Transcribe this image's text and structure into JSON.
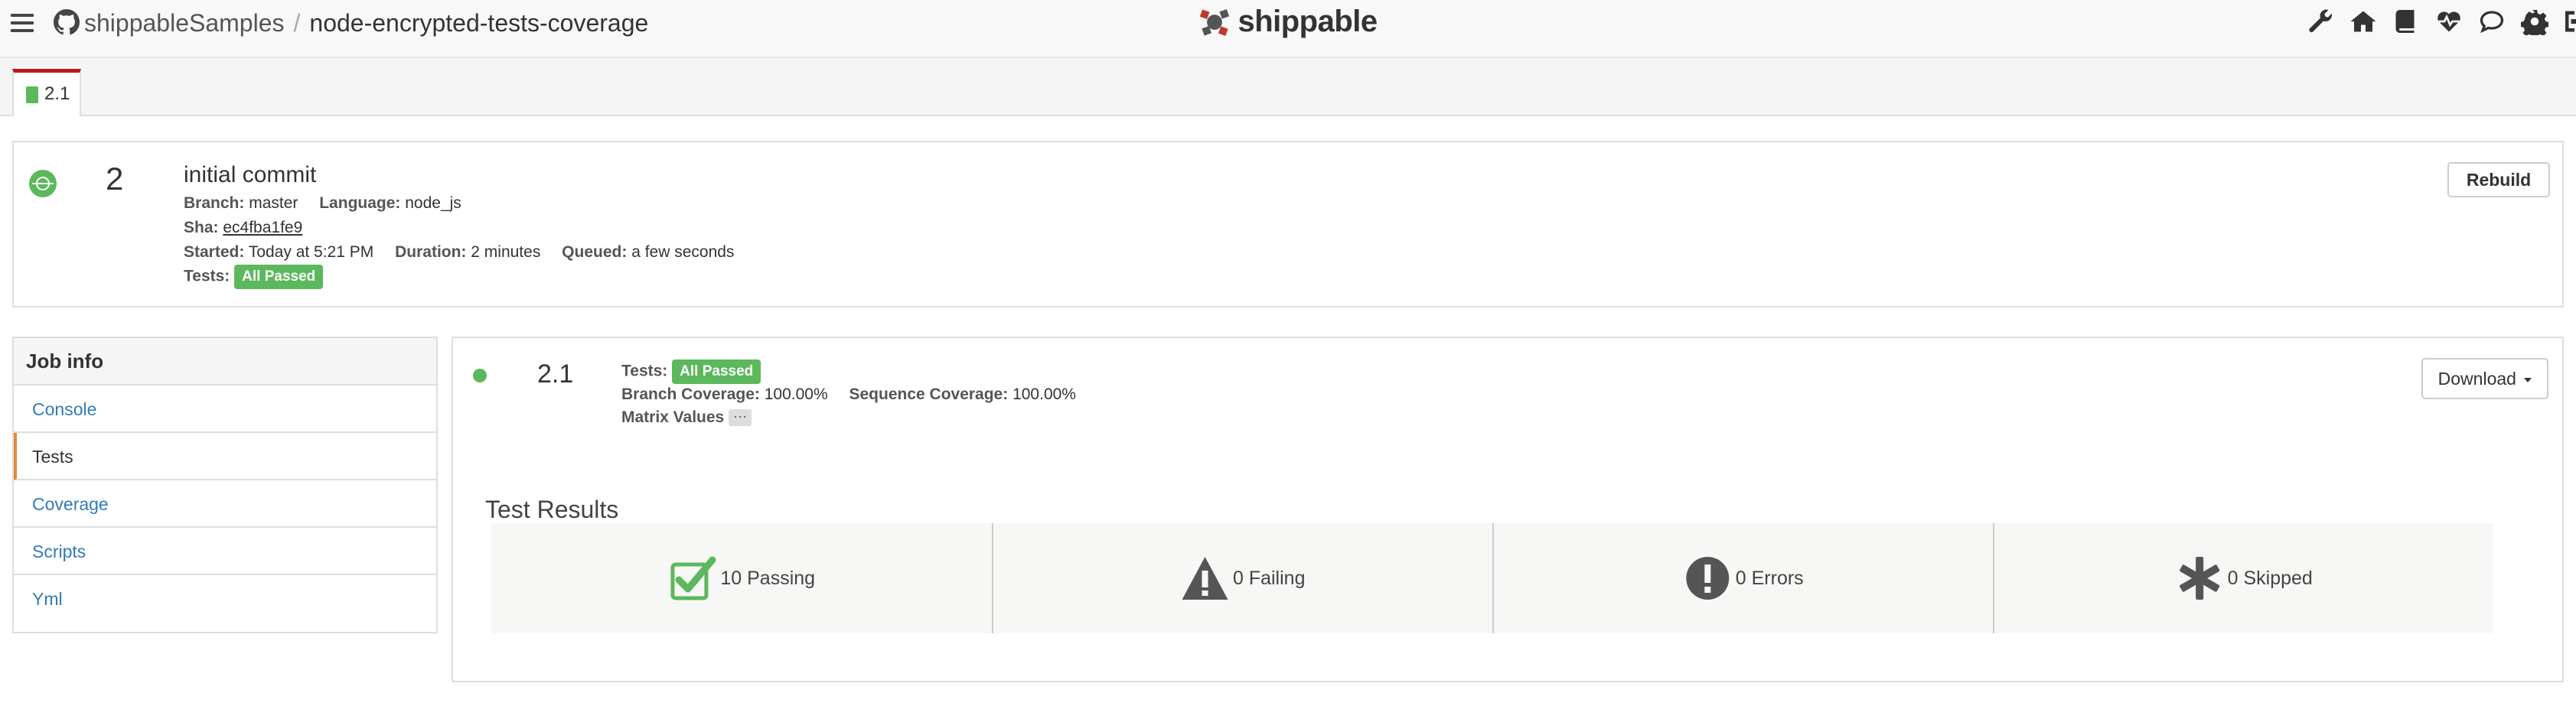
{
  "header": {
    "org": "shippableSamples",
    "separator": "/",
    "repo": "node-encrypted-tests-coverage",
    "brand": "shippable",
    "nav_icons": [
      "wrench-icon",
      "home-icon",
      "book-icon",
      "heartbeat-icon",
      "chat-icon",
      "gear-icon",
      "sign-out-icon"
    ]
  },
  "tabs": [
    {
      "label": "2.1",
      "status_color": "#5cb85c",
      "active_border": "#b91c1c"
    }
  ],
  "build": {
    "number": "2",
    "commit_message": "initial commit",
    "branch_label": "Branch:",
    "branch": "master",
    "language_label": "Language:",
    "language": "node_js",
    "sha_label": "Sha:",
    "sha": "ec4fba1fe9",
    "started_label": "Started:",
    "started": "Today at 5:21 PM",
    "duration_label": "Duration:",
    "duration": "2 minutes",
    "queued_label": "Queued:",
    "queued": "a few seconds",
    "tests_label": "Tests:",
    "tests_badge": "All Passed",
    "rebuild_label": "Rebuild",
    "status_color": "#5cb85c"
  },
  "job_info": {
    "title": "Job info",
    "items": [
      {
        "label": "Console",
        "active": false
      },
      {
        "label": "Tests",
        "active": true
      },
      {
        "label": "Coverage",
        "active": false
      },
      {
        "label": "Scripts",
        "active": false
      },
      {
        "label": "Yml",
        "active": false
      }
    ]
  },
  "job": {
    "number": "2.1",
    "tests_label": "Tests:",
    "tests_badge": "All Passed",
    "branch_coverage_label": "Branch Coverage:",
    "branch_coverage": "100.00%",
    "sequence_coverage_label": "Sequence Coverage:",
    "sequence_coverage": "100.00%",
    "matrix_label": "Matrix Values",
    "matrix_button": "···",
    "download_label": "Download"
  },
  "test_results": {
    "title": "Test Results",
    "cells": [
      {
        "icon": "checkbox-check-icon",
        "label": "10 Passing",
        "color": "#5cb85c"
      },
      {
        "icon": "warning-icon",
        "label": "0 Failing",
        "color": "#555555"
      },
      {
        "icon": "exclamation-circle-icon",
        "label": "0 Errors",
        "color": "#555555"
      },
      {
        "icon": "asterisk-icon",
        "label": "0 Skipped",
        "color": "#555555"
      }
    ]
  }
}
